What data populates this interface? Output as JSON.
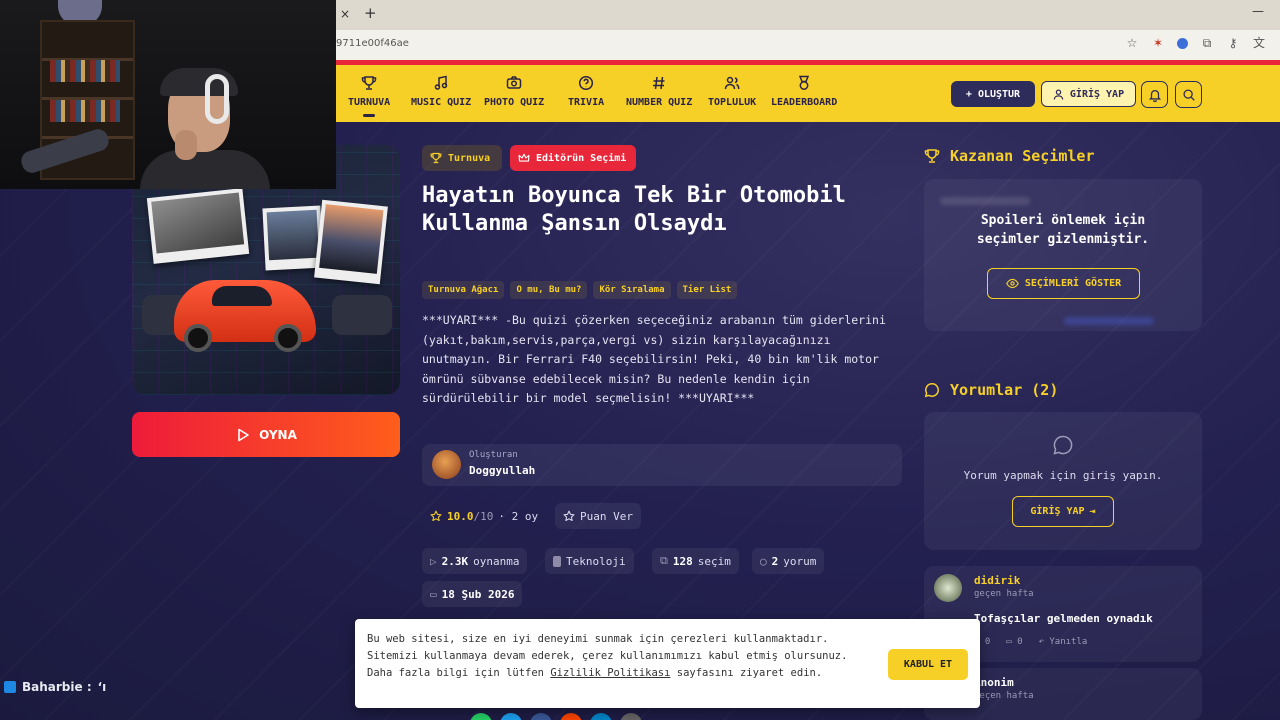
{
  "browser": {
    "url_fragment": "9711e00f46ae",
    "tab_close": "×",
    "tab_new": "+",
    "win_min": "—"
  },
  "nav": {
    "items": [
      {
        "label": "TURNUVA",
        "icon": "trophy-icon"
      },
      {
        "label": "MUSIC QUIZ",
        "icon": "music-icon"
      },
      {
        "label": "PHOTO QUIZ",
        "icon": "camera-icon"
      },
      {
        "label": "TRIVIA",
        "icon": "question-icon"
      },
      {
        "label": "NUMBER QUIZ",
        "icon": "hash-icon"
      },
      {
        "label": "TOPLULUK",
        "icon": "users-icon"
      },
      {
        "label": "LEADERBOARD",
        "icon": "medal-icon"
      }
    ],
    "create_label": "OLUŞTUR",
    "login_label": "GİRİŞ YAP"
  },
  "quiz": {
    "tag_type": "Turnuva",
    "tag_editor": "Editörün Seçimi",
    "title": "Hayatın Boyunca Tek Bir Otomobil Kullanma Şansın Olsaydı",
    "categories": [
      "Turnuva Ağacı",
      "O mu, Bu mu?",
      "Kör Sıralama",
      "Tier List"
    ],
    "description": "***UYARI*** -Bu quizi çözerken seçeceğiniz arabanın tüm giderlerini (yakıt,bakım,servis,parça,vergi vs) sizin karşılayacağınızı unutmayın. Bir Ferrari F40 seçebilirsin! Peki, 40 bin km'lik motor ömrünü sübvanse edebilecek misin? Bu nedenle kendin için sürdürülebilir bir model seçmelisin! ***UYARI***",
    "creator_label": "Oluşturan",
    "creator_name": "Doggyullah",
    "rating": "10.0",
    "rating_max": "/10",
    "rating_count": "· 2 oy",
    "rate_label": "Puan Ver",
    "plays": "2.3K",
    "plays_label": "oynanma",
    "category": "Teknoloji",
    "choices": "128",
    "choices_label": "seçim",
    "comments_count": "2",
    "comments_label": "yorum",
    "date": "18 Şub 2026",
    "play_label": "OYNA"
  },
  "winners": {
    "title": "Kazanan Seçimler",
    "spoiler_line1": "Spoileri önlemek için",
    "spoiler_line2": "seçimler gizlenmiştir.",
    "show_label": "SEÇİMLERİ GÖSTER"
  },
  "comments": {
    "title": "Yorumlar (2)",
    "login_prompt": "Yorum yapmak için giriş yapın.",
    "login_label": "GİRİŞ YAP",
    "items": [
      {
        "name": "didirik",
        "time": "geçen hafta",
        "text": "Tofaşçılar gelmeden oynadık",
        "likes": "0",
        "replies": "0",
        "reply_label": "Yanıtla"
      },
      {
        "name": "Anonim",
        "time": "geçen hafta",
        "text": "",
        "likes": "",
        "replies": "",
        "reply_label": ""
      }
    ]
  },
  "cookie": {
    "text_part1": "Bu web sitesi, size en iyi deneyimi sunmak için çerezleri kullanmaktadır. Sitemizi kullanmaya devam ederek, çerez kullanımımızı kabul etmiş olursunuz. Daha fazla bilgi için lütfen ",
    "policy_link": "Gizlilik Politikası",
    "text_part2": " sayfasını ziyaret edin.",
    "accept_label": "KABUL ET"
  },
  "stream": {
    "chat_user": "Baharbie :",
    "chat_msg": "‘ı"
  },
  "colors": {
    "accent_yellow": "#f7d027",
    "nav_dark": "#2e2c5a",
    "red": "#e8283a",
    "bg": "#1f1d45"
  }
}
